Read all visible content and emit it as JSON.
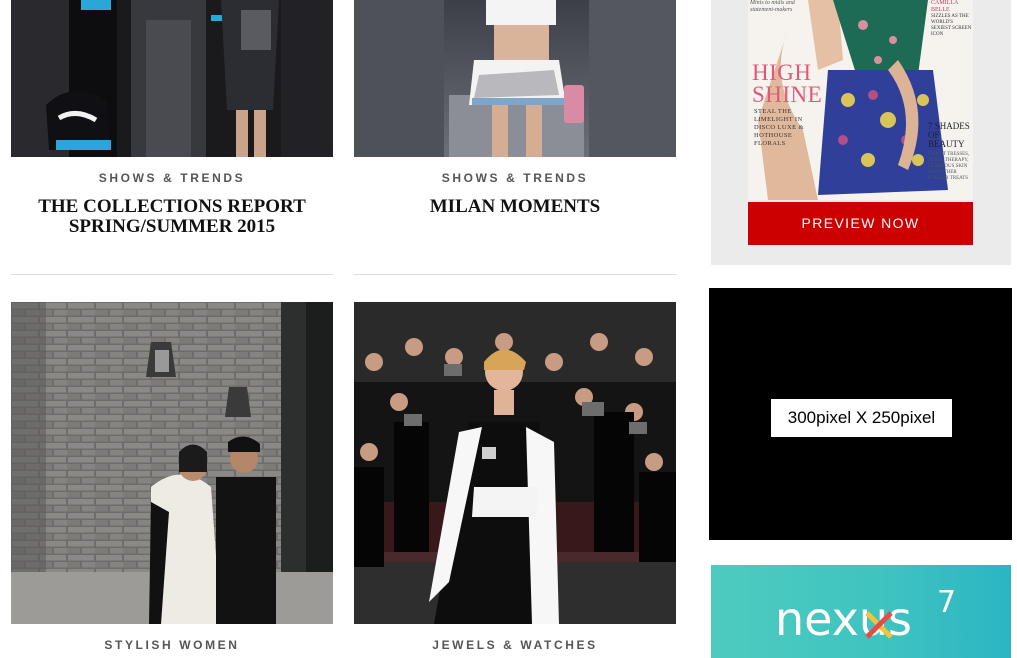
{
  "articles": [
    {
      "category": "SHOWS & TRENDS",
      "title": "THE COLLECTIONS REPORT SPRING/SUMMER 2015"
    },
    {
      "category": "SHOWS & TRENDS",
      "title": "MILAN MOMENTS"
    },
    {
      "category": "STYLISH WOMEN",
      "title": ""
    },
    {
      "category": "JEWELS & WATCHES",
      "title": ""
    }
  ],
  "sidebar": {
    "magazine": {
      "cover_lines": {
        "top": "Minis to midis and statement-makers",
        "headline": "HIGH SHINE",
        "sub": "STEAL THE LIMELIGHT IN DISCO LUXE & HOTHOUSE FLORALS",
        "right_name": "CAMILLA BELLE",
        "right_sub": "SIZZLES AS THE WORLD'S SEXIEST SCREEN ICON",
        "shades": "7 SHADES OF BEAUTY",
        "shades_sub": "VIOLET TRESSES, JEWEL THERAPY, LUMINOUS SKIN AND OTHER COLOUR TREATS"
      },
      "button_label": "PREVIEW NOW"
    },
    "ad_black": {
      "label": "300pixel X 250pixel"
    },
    "ad_nexus": {
      "brand": "nexus",
      "model": "7"
    }
  },
  "colors": {
    "button_red": "#cc0000",
    "sidebar_gray": "#ebebeb",
    "nexus_teal": "#3ec3c0"
  }
}
